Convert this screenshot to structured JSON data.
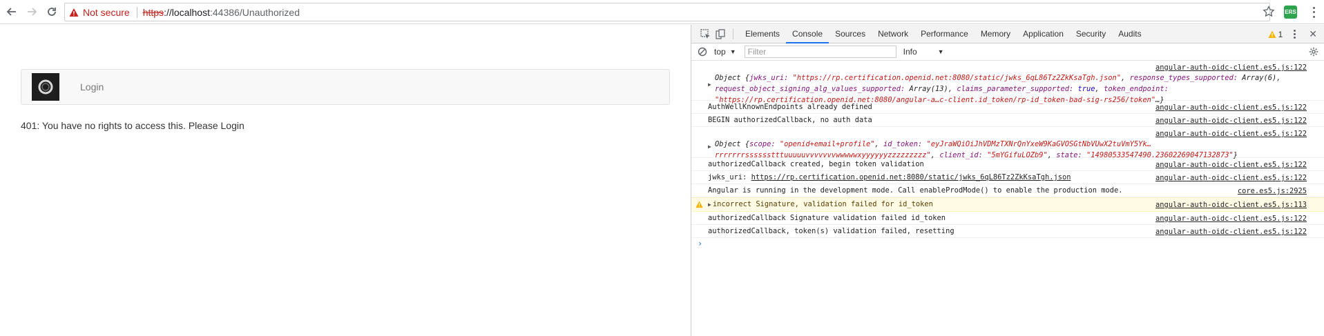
{
  "browser": {
    "not_secure": "Not secure",
    "url_scheme": "https",
    "url_host": "://localhost",
    "url_rest": ":44386/Unauthorized",
    "ext_label": "ERS"
  },
  "page": {
    "login_label": "Login",
    "message": "401: You have no rights to access this. Please Login"
  },
  "devtools": {
    "tabs": [
      "Elements",
      "Console",
      "Sources",
      "Network",
      "Performance",
      "Memory",
      "Application",
      "Security",
      "Audits"
    ],
    "active_tab": "Console",
    "warning_count": "1",
    "context": "top",
    "filter_placeholder": "Filter",
    "level": "Info"
  },
  "console": {
    "r1": {
      "src": "angular-auth-oidc-client.es5.js:122",
      "p1": "Object {",
      "k1": "jwks_uri: ",
      "v1": "\"https://rp.certification.openid.net:8080/static/jwks_6qL86Tz2ZkKsaTgh.json\"",
      "p2": ", ",
      "k2": "response_types_supported: ",
      "v2": "Array(6)",
      "p3": ", ",
      "k3": "request_object_signing_alg_values_supported: ",
      "v3": "Array(13)",
      "p4": ", ",
      "k4": "claims_parameter_supported: ",
      "v4": "true",
      "p5": ", ",
      "k5": "token_endpoint: ",
      "v5": "\"https://rp.certification.openid.net:8080/angular-a…c-client.id_token/rp-id_token-bad-sig-rs256/token\"",
      "p6": "…}"
    },
    "r2": {
      "txt": "AuthWellKnownEndpoints already defined",
      "src": "angular-auth-oidc-client.es5.js:122"
    },
    "r3": {
      "txt": "BEGIN authorizedCallback, no auth data",
      "src": "angular-auth-oidc-client.es5.js:122"
    },
    "r4": {
      "src": "angular-auth-oidc-client.es5.js:122",
      "p1": "Object {",
      "k1": "scope: ",
      "v1": "\"openid+email+profile\"",
      "p2": ", ",
      "k2": "id_token: ",
      "v2": "\"eyJraWQiOiJhVDMzTXNrQnYxeW9KaGVOSGtNbVUwX2tuVmY5Yk…rrrrrrrsssssstttuuuuuvvvvvvvwwwwwxyyyyyyzzzzzzzzz\"",
      "p3": ", ",
      "k3": "client_id: ",
      "v3": "\"5mYGifuLOZb9\"",
      "p4": ", ",
      "k4": "state: ",
      "v4": "\"14980533547490.23602269047132873\"",
      "p5": "}"
    },
    "r5": {
      "txt": "authorizedCallback created, begin token validation",
      "src": "angular-auth-oidc-client.es5.js:122"
    },
    "r6": {
      "pre": "jwks_uri: ",
      "link": "https://rp.certification.openid.net:8080/static/jwks_6qL86Tz2ZkKsaTgh.json",
      "src": "angular-auth-oidc-client.es5.js:122"
    },
    "r7": {
      "txt": "Angular is running in the development mode. Call enableProdMode() to enable the production mode.",
      "src": "core.es5.js:2925"
    },
    "r8": {
      "txt": "incorrect Signature, validation failed for id_token",
      "src": "angular-auth-oidc-client.es5.js:113"
    },
    "r9": {
      "txt": "authorizedCallback Signature validation failed id_token",
      "src": "angular-auth-oidc-client.es5.js:122"
    },
    "r10": {
      "txt": "authorizedCallback, token(s) validation failed, resetting",
      "src": "angular-auth-oidc-client.es5.js:122"
    }
  }
}
